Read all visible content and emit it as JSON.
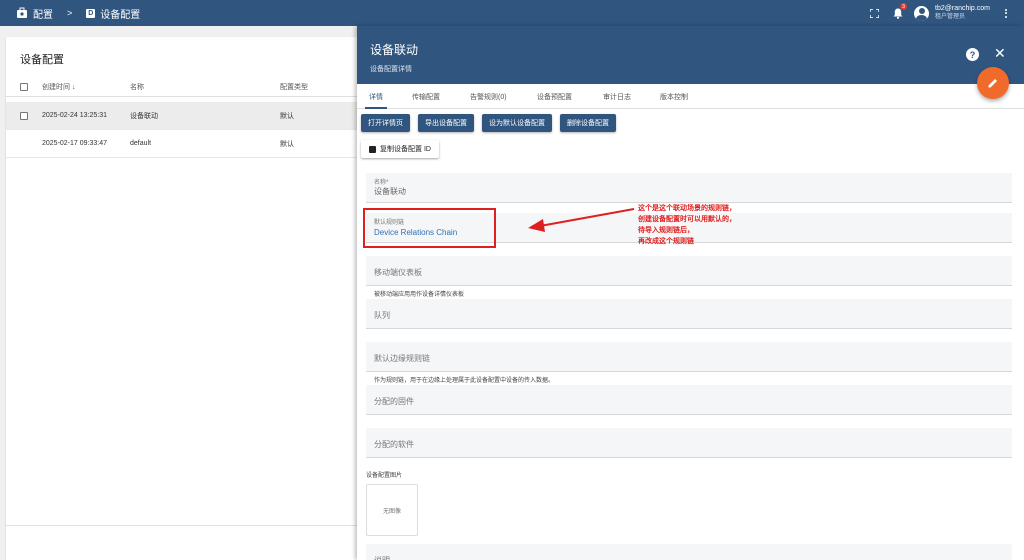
{
  "topbar": {
    "crumb_root": "配置",
    "crumb_sep": ">",
    "crumb_current_icon_letter": "D",
    "crumb_current": "设备配置",
    "notification_count": "3",
    "user_email": "tb2@ranchip.com",
    "user_role": "租户管理员"
  },
  "list": {
    "title": "设备配置",
    "columns": {
      "created": "创建时间 ↓",
      "name": "名称",
      "type": "配置类型"
    },
    "rows": [
      {
        "created": "2025-02-24 13:25:31",
        "name": "设备联动",
        "type": "默认"
      },
      {
        "created": "2025-02-17 09:33:47",
        "name": "default",
        "type": "默认"
      }
    ]
  },
  "drawer": {
    "title": "设备联动",
    "subtitle": "设备配置详情",
    "tabs": [
      "详情",
      "传输配置",
      "告警规则(0)",
      "设备预配置",
      "审计日志",
      "版本控制"
    ],
    "buttons": {
      "open_details": "打开详情页",
      "export": "导出设备配置",
      "set_default": "设为默认设备配置",
      "delete": "删除设备配置",
      "copy_id": "复制设备配置 ID"
    },
    "fields": {
      "name_label": "名称*",
      "name_value": "设备联动",
      "rule_chain_label": "默认规则链",
      "rule_chain_value": "Device Relations Chain",
      "mobile_dashboard": "移动端仪表板",
      "mobile_hint": "被移动端应用用作设备详情仪表板",
      "queue": "队列",
      "edge_rule_chain": "默认边缘规则链",
      "edge_hint": "作为规则链，用于在边缘上处理属于此设备配置中设备的传入数据。",
      "firmware": "分配的固件",
      "software": "分配的软件",
      "image_label": "设备配置图片",
      "no_image": "无图像",
      "description": "说明"
    }
  },
  "annotation": {
    "lines": [
      "这个是这个联动场景的规则链，",
      "创建设备配置时可以用默认的，",
      "待导入规则链后，",
      "再改成这个规则链"
    ]
  },
  "colors": {
    "header": "#305680",
    "fab": "#f06a2b",
    "annotation": "#e02020",
    "link": "#2e6fb7"
  }
}
